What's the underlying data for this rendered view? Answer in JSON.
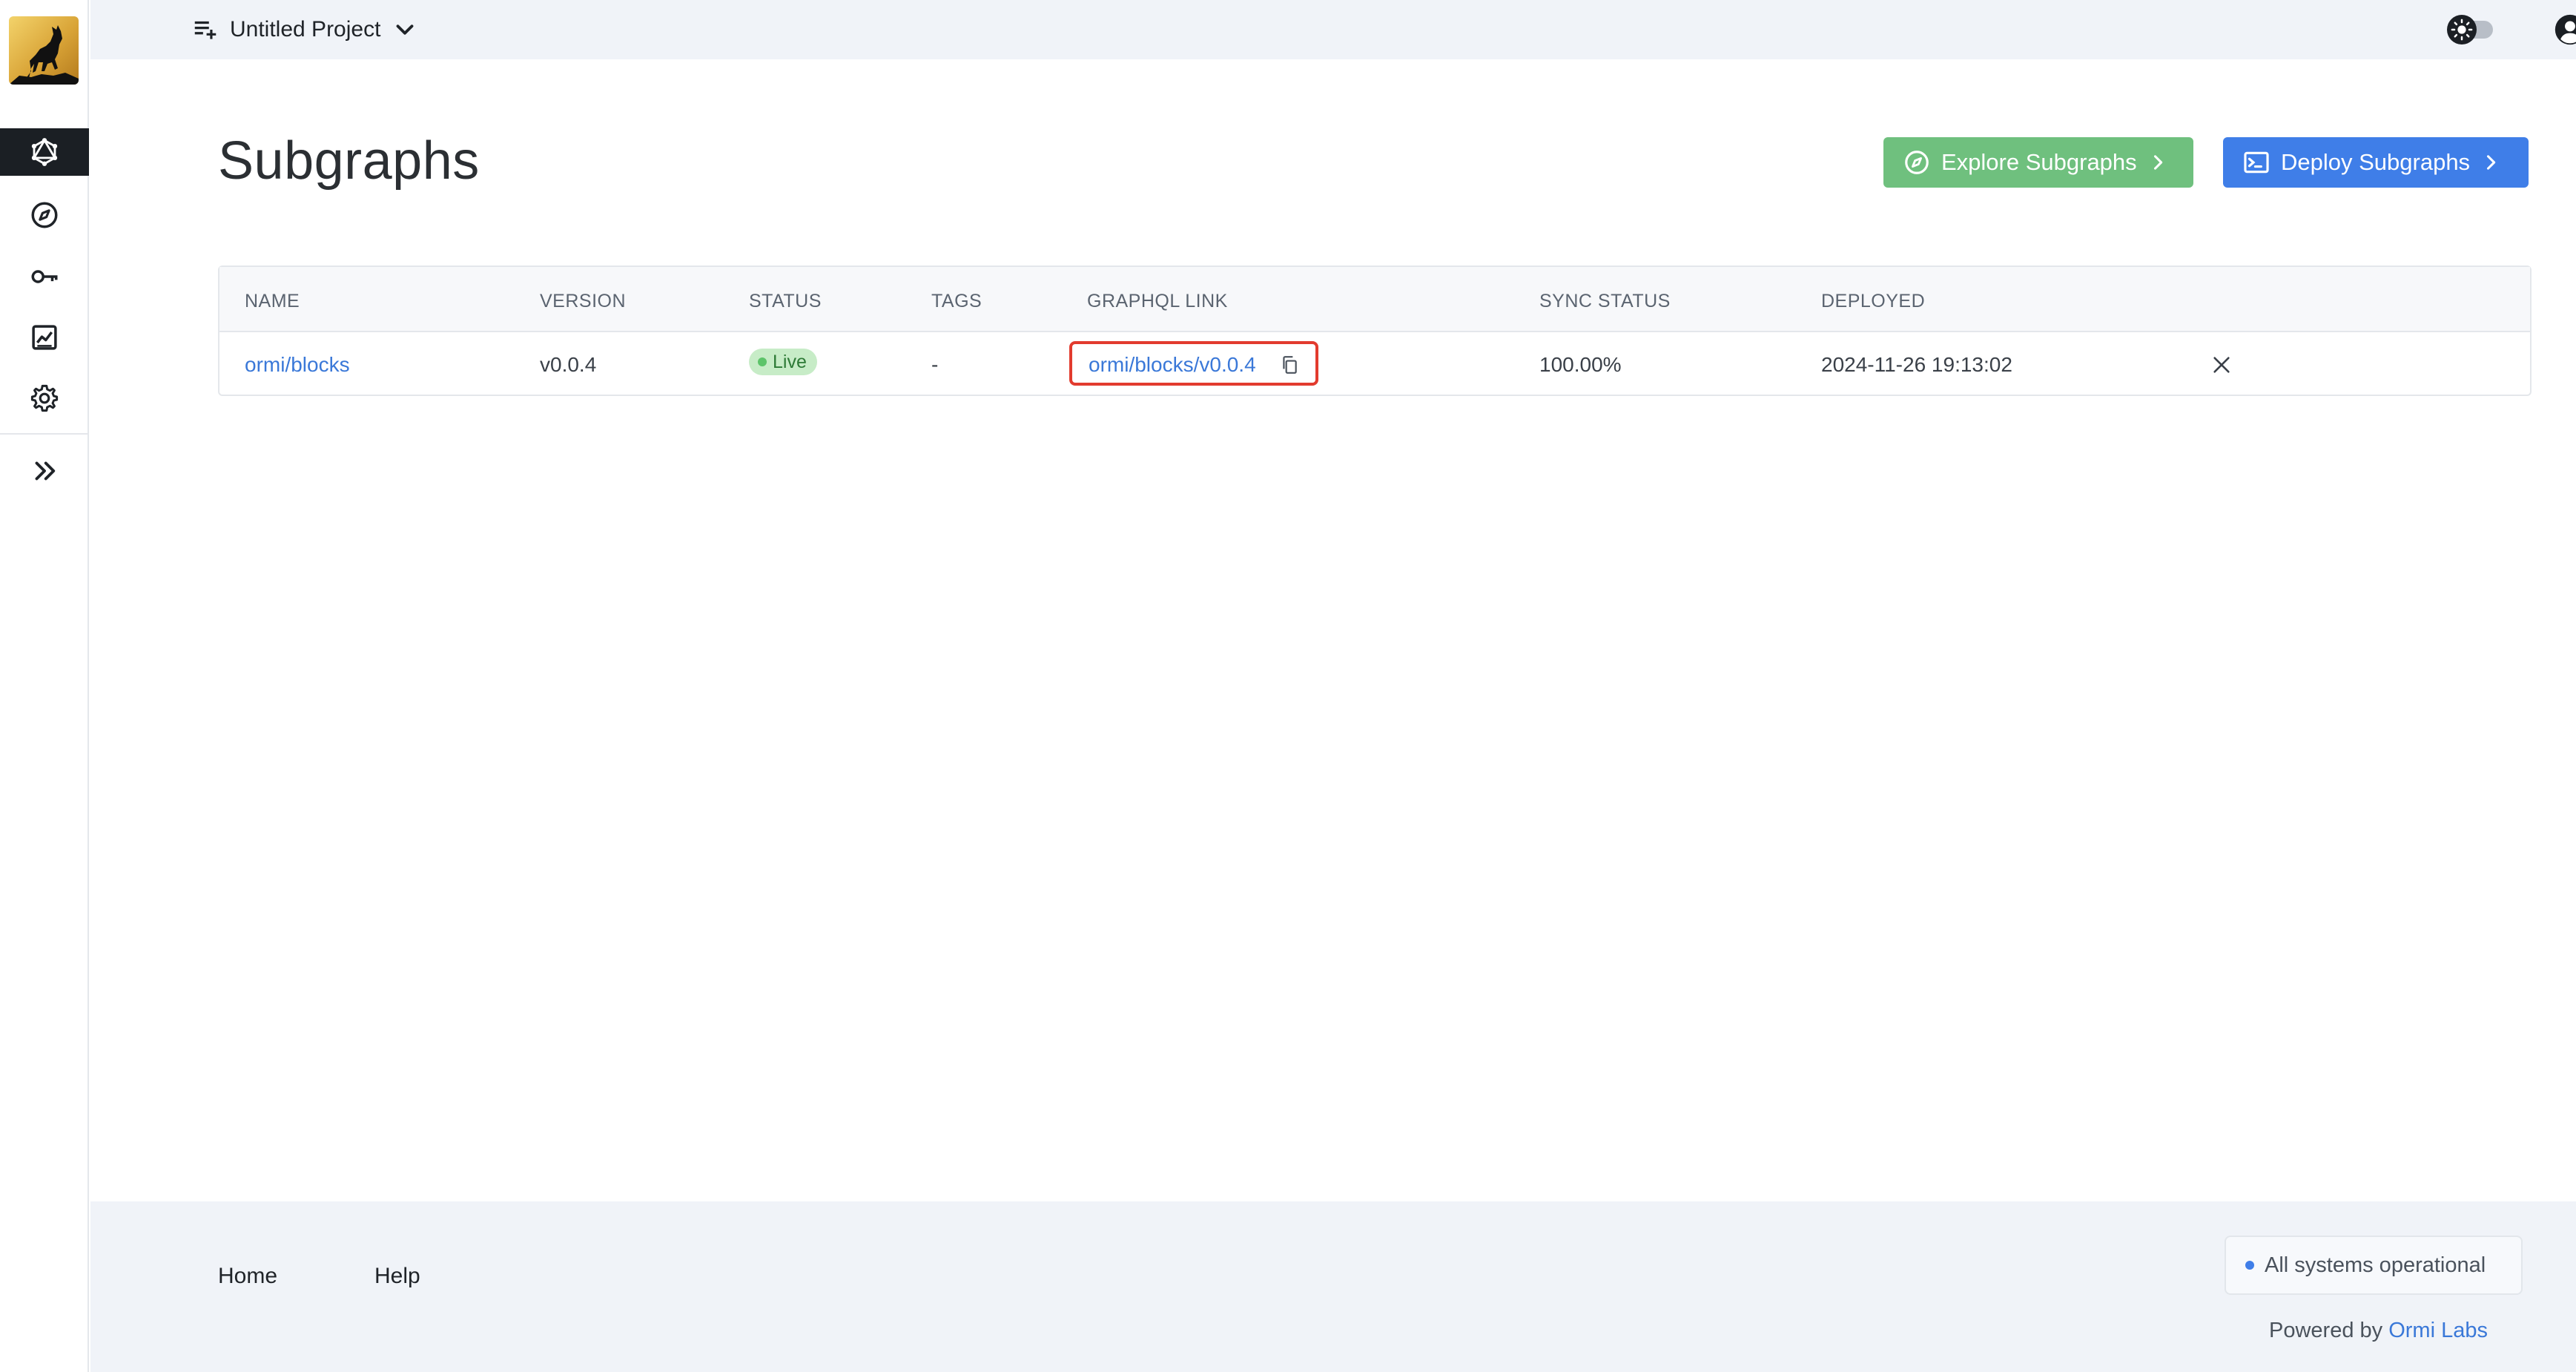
{
  "topbar": {
    "project_name": "Untitled Project"
  },
  "sidebar": {
    "items": [
      {
        "name": "subgraphs",
        "icon": "graphql-icon",
        "active": true
      },
      {
        "name": "explore",
        "icon": "compass-icon",
        "active": false
      },
      {
        "name": "api-keys",
        "icon": "key-icon",
        "active": false
      },
      {
        "name": "analytics",
        "icon": "chart-icon",
        "active": false
      },
      {
        "name": "settings",
        "icon": "gear-icon",
        "active": false
      },
      {
        "name": "expand",
        "icon": "chevrons-right-icon",
        "active": false
      }
    ]
  },
  "page": {
    "title": "Subgraphs",
    "explore_button": "Explore Subgraphs",
    "deploy_button": "Deploy Subgraphs"
  },
  "table": {
    "headers": [
      "NAME",
      "VERSION",
      "STATUS",
      "TAGS",
      "GRAPHQL LINK",
      "SYNC STATUS",
      "DEPLOYED"
    ],
    "rows": [
      {
        "name": "ormi/blocks",
        "version": "v0.0.4",
        "status": "Live",
        "tags": "-",
        "graphql_link": "ormi/blocks/v0.0.4",
        "sync_status": "100.00%",
        "deployed": "2024-11-26 19:13:02"
      }
    ]
  },
  "footer": {
    "home": "Home",
    "help": "Help",
    "system_status": "All systems operational",
    "powered_by_prefix": "Powered by",
    "powered_by_link": "Ormi Labs"
  },
  "colors": {
    "accent_blue": "#3f7ee8",
    "explore_green": "#6fc07e",
    "live_badge_bg": "#c7ecc7",
    "highlight_red": "#e23b2e"
  }
}
